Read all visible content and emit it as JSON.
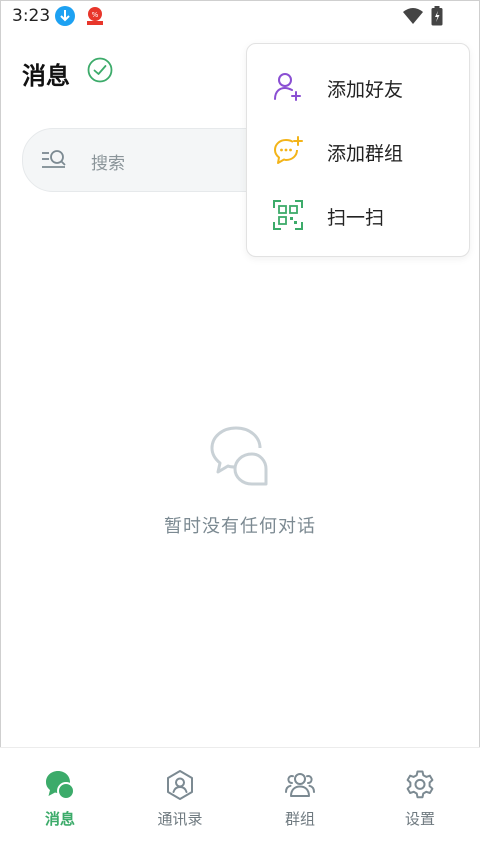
{
  "status_bar": {
    "time": "3:23"
  },
  "header": {
    "title": "消息"
  },
  "search": {
    "placeholder": "搜索"
  },
  "popup_menu": {
    "items": [
      {
        "label": "添加好友",
        "icon": "add-friend-icon"
      },
      {
        "label": "添加群组",
        "icon": "add-group-icon"
      },
      {
        "label": "扫一扫",
        "icon": "scan-qr-icon"
      }
    ]
  },
  "empty_state": {
    "text": "暂时没有任何对话",
    "icon": "chat-bubbles-icon"
  },
  "bottom_nav": {
    "items": [
      {
        "label": "消息",
        "icon": "message-icon",
        "active": true
      },
      {
        "label": "通讯录",
        "icon": "contacts-icon",
        "active": false
      },
      {
        "label": "群组",
        "icon": "group-icon",
        "active": false
      },
      {
        "label": "设置",
        "icon": "settings-icon",
        "active": false
      }
    ]
  },
  "colors": {
    "accent_green": "#3cab6a",
    "add_friend_purple": "#8a4fd3",
    "add_group_yellow": "#f3b419",
    "scan_green": "#3cab6a",
    "muted_text": "#7c8a92"
  }
}
